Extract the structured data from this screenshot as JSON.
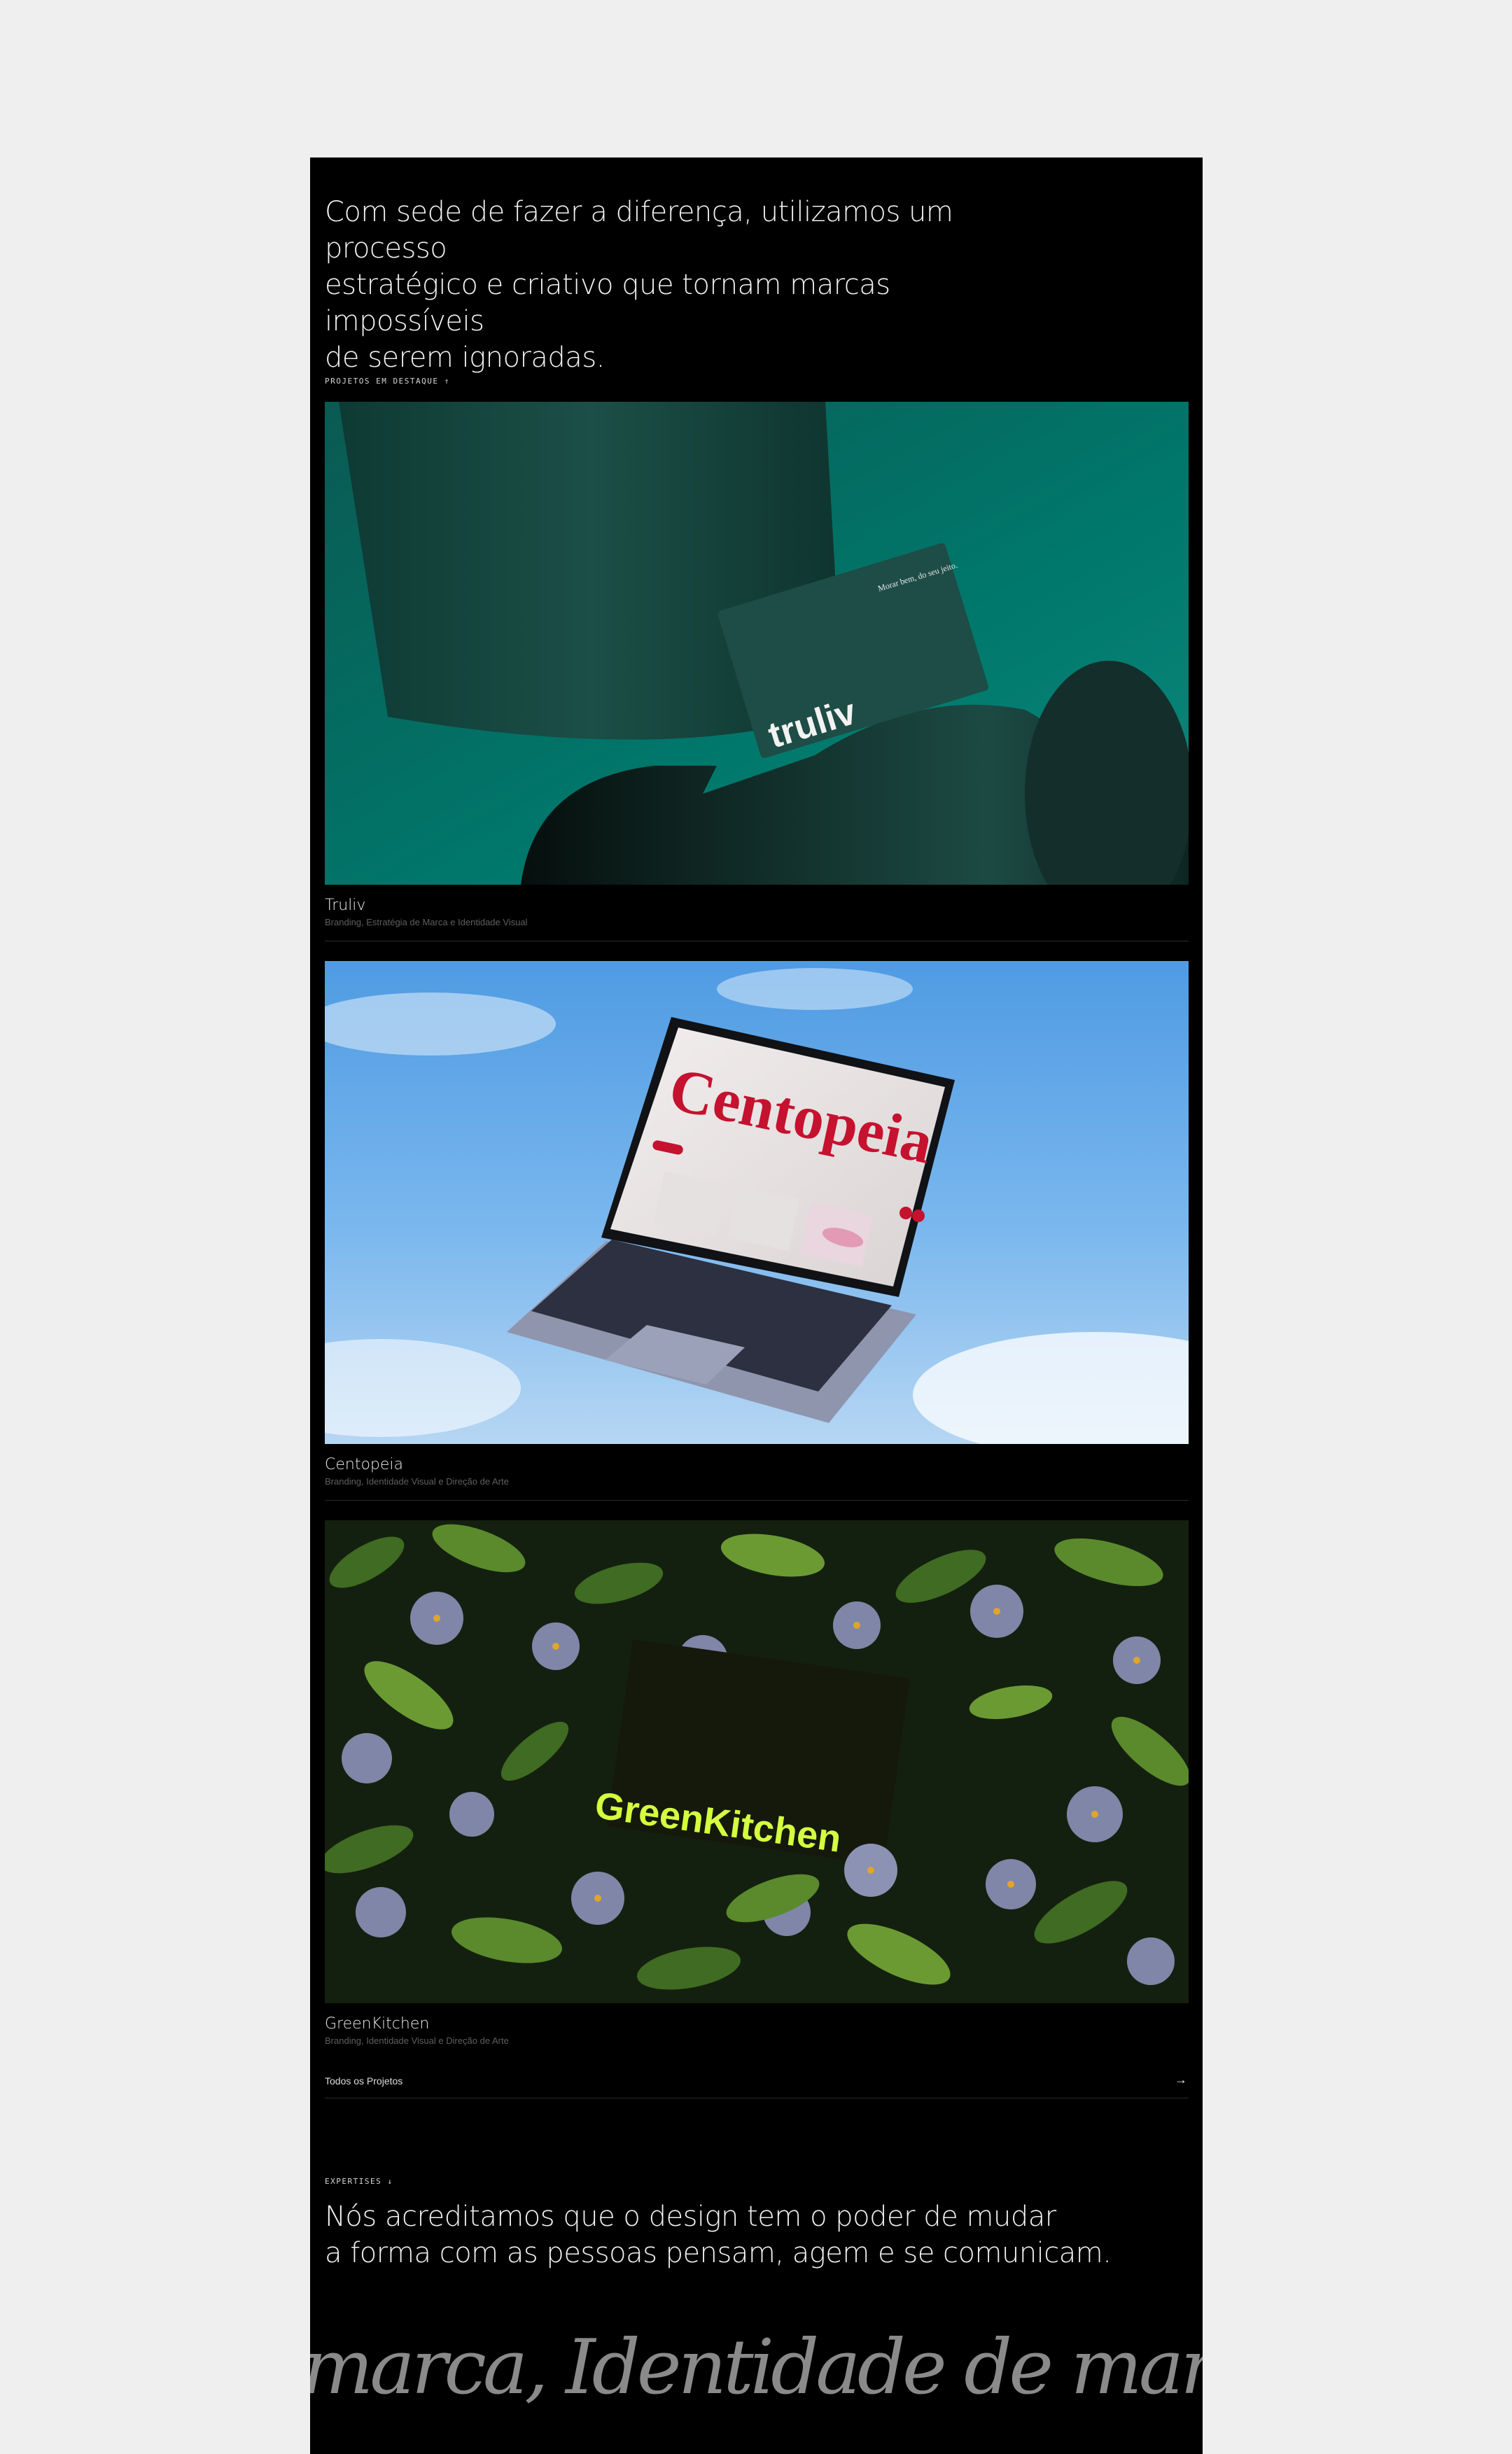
{
  "intro": {
    "lines": [
      "Com sede de fazer a diferença, utilizamos um processo",
      "estratégico e criativo que tornam marcas impossíveis",
      "de serem ignoradas."
    ]
  },
  "featured": {
    "label": "PROJETOS EM DESTAQUE ↑"
  },
  "projects": [
    {
      "title": "Truliv",
      "subtitle": "Branding, Estratégia de Marca e Identidade Visual",
      "image_text": {
        "logo": "truliv",
        "tagline": "Morar bem, do seu jeito."
      }
    },
    {
      "title": "Centopeia",
      "subtitle": "Branding, Identidade Visual e Direção de Arte",
      "image_text": {
        "logo": "Centopeia"
      }
    },
    {
      "title": "GreenKitchen",
      "subtitle": "Branding, Identidade Visual e Direção de Arte",
      "image_text": {
        "logo": "GreenKitchen"
      }
    }
  ],
  "all_projects": {
    "label": "Todos os Projetos",
    "arrow": "→"
  },
  "expertises": {
    "label": "EXPERTISES ↓",
    "lines": [
      "Nós acreditamos que o design tem o poder de mudar",
      "a forma com as pessoas pensam, agem e se comunicam."
    ]
  },
  "marquee": {
    "text": "marca, Identidade de marca, Experiên"
  },
  "colors": {
    "page_bg": "#efefef",
    "panel_bg": "#000000",
    "truliv_teal": "#00766b",
    "sky_blue": "#6aaee9",
    "greenkitchen_lime": "#d4ff3f"
  }
}
